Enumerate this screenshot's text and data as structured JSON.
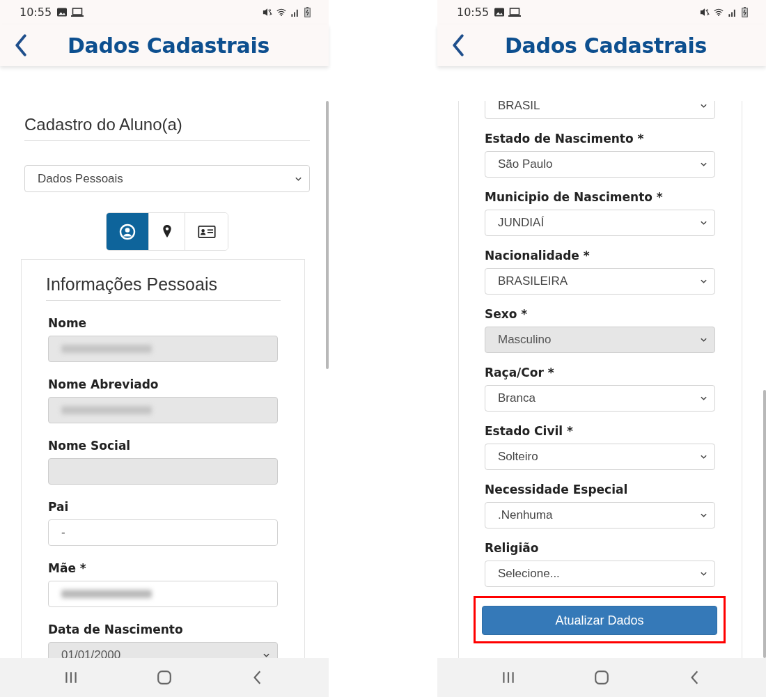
{
  "screens": [
    {
      "status_bar": {
        "time": "10:55"
      },
      "app_bar": {
        "title": "Dados Cadastrais"
      },
      "page_title": "Cadastro do Aluno(a)",
      "section_select": {
        "value": "Dados Pessoais"
      },
      "tabs": [
        {
          "selected": true
        },
        {
          "selected": false
        },
        {
          "selected": false
        }
      ],
      "panel": {
        "heading": "Informações Pessoais",
        "fields": [
          {
            "label": "Nome",
            "kind": "input",
            "disabled": true,
            "redacted": true
          },
          {
            "label": "Nome Abreviado",
            "kind": "input",
            "disabled": true,
            "redacted": true
          },
          {
            "label": "Nome Social",
            "kind": "input",
            "disabled": true,
            "redacted": false
          },
          {
            "label": "Pai",
            "kind": "input",
            "disabled": false,
            "redacted": false,
            "value": "-"
          },
          {
            "label": "Mãe *",
            "kind": "input",
            "disabled": false,
            "redacted": true
          },
          {
            "label": "Data de Nascimento",
            "kind": "select",
            "disabled": true,
            "redacted": false,
            "value": "01/01/2000"
          }
        ]
      }
    },
    {
      "status_bar": {
        "time": "10:55"
      },
      "app_bar": {
        "title": "Dados Cadastrais"
      },
      "panel": {
        "fields": [
          {
            "kind": "select",
            "disabled": false,
            "redacted": false,
            "value": "BRASIL"
          },
          {
            "label": "Estado de Nascimento *",
            "kind": "select",
            "disabled": false,
            "redacted": false,
            "value": "São Paulo"
          },
          {
            "label": "Municipio de Nascimento *",
            "kind": "select",
            "disabled": false,
            "redacted": false,
            "value": "JUNDIAÍ"
          },
          {
            "label": "Nacionalidade *",
            "kind": "select",
            "disabled": false,
            "redacted": false,
            "value": "BRASILEIRA"
          },
          {
            "label": "Sexo *",
            "kind": "select",
            "disabled": true,
            "redacted": false,
            "value": "Masculino"
          },
          {
            "label": "Raça/Cor *",
            "kind": "select",
            "disabled": false,
            "redacted": false,
            "value": "Branca"
          },
          {
            "label": "Estado Civil *",
            "kind": "select",
            "disabled": false,
            "redacted": false,
            "value": "Solteiro"
          },
          {
            "label": "Necessidade Especial",
            "kind": "select",
            "disabled": false,
            "redacted": false,
            "value": ".Nenhuma"
          },
          {
            "label": "Religião",
            "kind": "select",
            "disabled": false,
            "redacted": false,
            "value": "Selecione..."
          }
        ],
        "button": {
          "label": "Atualizar Dados",
          "highlighted": true
        }
      }
    }
  ]
}
